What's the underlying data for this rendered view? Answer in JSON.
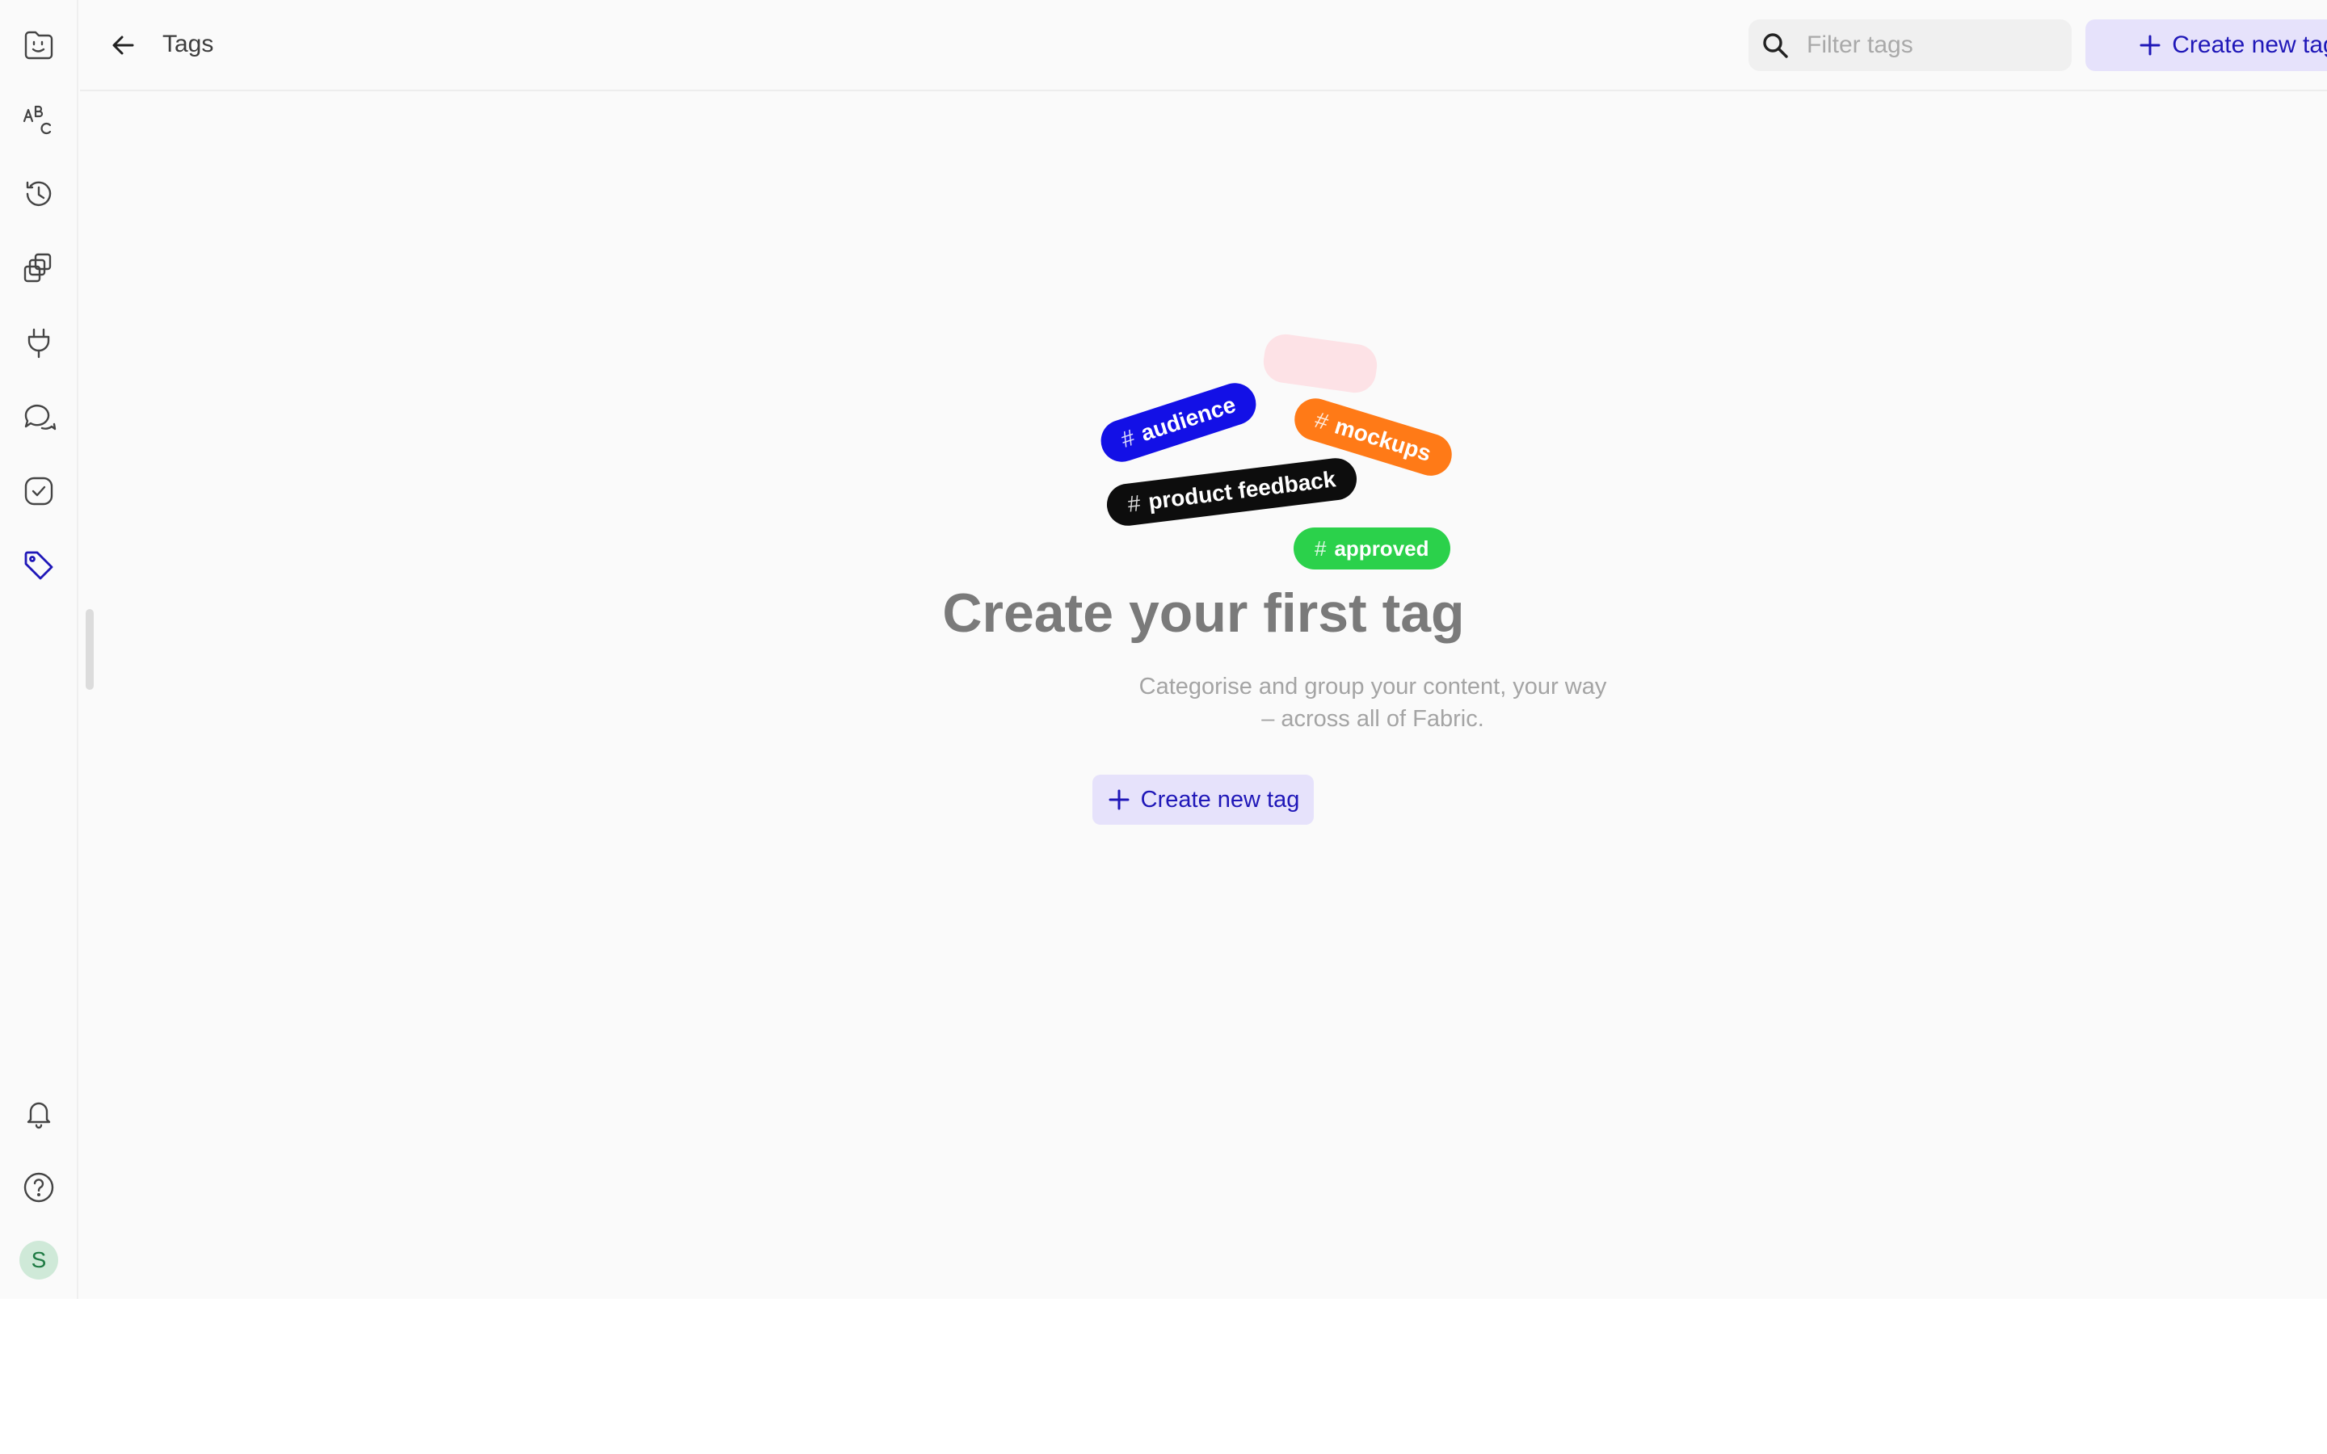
{
  "header": {
    "title": "Tags",
    "search_placeholder": "Filter tags",
    "create_label": "Create new tag"
  },
  "sidebar": {
    "items": [
      {
        "icon": "fabric-logo-icon",
        "active": false
      },
      {
        "icon": "spellcheck-icon",
        "active": false
      },
      {
        "icon": "history-icon",
        "active": false
      },
      {
        "icon": "spaces-icon",
        "active": false
      },
      {
        "icon": "plug-icon",
        "active": false
      },
      {
        "icon": "chat-icon",
        "active": false
      },
      {
        "icon": "check-circle-icon",
        "active": false
      },
      {
        "icon": "tag-icon",
        "active": true
      }
    ],
    "bottom": [
      {
        "icon": "bell-icon"
      },
      {
        "icon": "help-icon"
      }
    ],
    "avatar_initial": "S"
  },
  "empty_state": {
    "tags": [
      {
        "label": "audience",
        "color": "#1310e6"
      },
      {
        "label": "mockups",
        "color": "#ff7a17"
      },
      {
        "label": "product feedback",
        "color": "#0d0d0d"
      },
      {
        "label": "approved",
        "color": "#2bd14b"
      }
    ],
    "hash": "#",
    "title": "Create your first tag",
    "description_line1": "Categorise and group your content, your way",
    "description_line2": "– across all of Fabric.",
    "create_label": "Create new tag"
  },
  "colors": {
    "accent": "#1f17b8",
    "accent_bg": "#e6e2fb",
    "active_icon": "#1f17b8"
  }
}
